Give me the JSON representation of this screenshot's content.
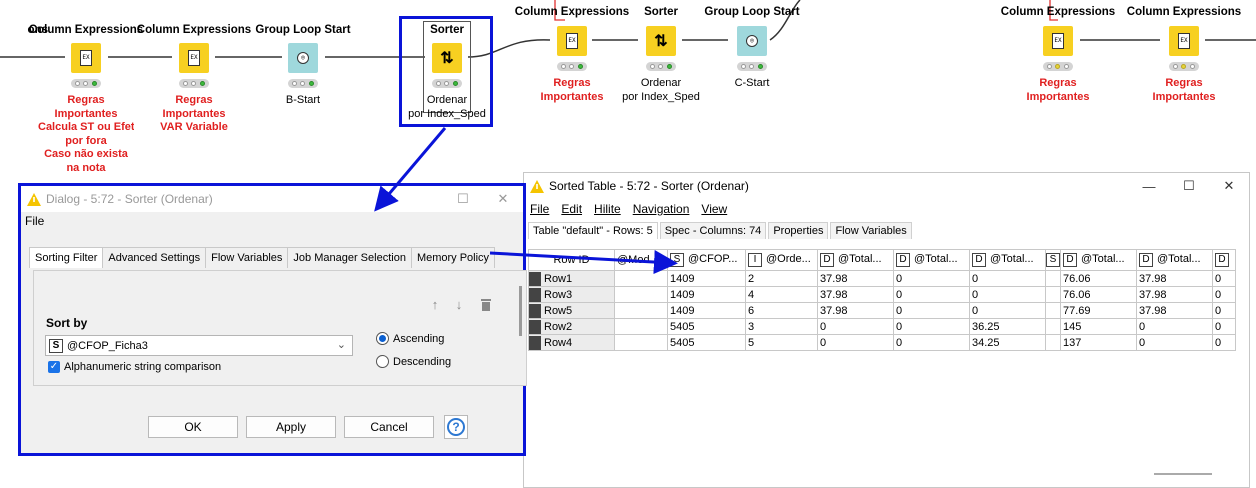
{
  "canvas": {
    "nodes": [
      {
        "title": "ons",
        "label": [],
        "status": [
          "w",
          "w",
          "w"
        ],
        "type": "none"
      },
      {
        "title": "Column Expressions",
        "label": [
          "Regras",
          "Importantes",
          "Calcula ST ou Efetivo",
          "por fora",
          "Caso não exista",
          "na nota"
        ],
        "status": [
          "w",
          "w",
          "g"
        ],
        "type": "expr"
      },
      {
        "title": "Column Expressions",
        "label": [
          "Regras",
          "Importantes",
          "VAR Variable"
        ],
        "status": [
          "w",
          "w",
          "g"
        ],
        "type": "expr"
      },
      {
        "title": "Group Loop Start",
        "label": [
          "B-Start"
        ],
        "status": [
          "w",
          "w",
          "g"
        ],
        "type": "loop"
      },
      {
        "title": "Sorter",
        "label": [
          "Ordenar",
          "por Index_Sped"
        ],
        "status": [
          "w",
          "w",
          "g"
        ],
        "type": "sort"
      },
      {
        "title": "Column Expressions",
        "label": [
          "Regras",
          "Importantes"
        ],
        "status": [
          "w",
          "w",
          "g"
        ],
        "type": "expr"
      },
      {
        "title": "Sorter",
        "label": [
          "Ordenar",
          "por Index_Sped"
        ],
        "status": [
          "w",
          "w",
          "g"
        ],
        "type": "sort"
      },
      {
        "title": "Group Loop Start",
        "label": [
          "C-Start"
        ],
        "status": [
          "w",
          "w",
          "g"
        ],
        "type": "loop"
      },
      {
        "title": "Column Expressions",
        "label": [
          "Regras",
          "Importantes"
        ],
        "status": [
          "w",
          "y",
          "w"
        ],
        "type": "expr"
      },
      {
        "title": "Column Expressions",
        "label": [
          "Regras",
          "Importantes"
        ],
        "status": [
          "w",
          "y",
          "w"
        ],
        "type": "expr"
      }
    ]
  },
  "dialog": {
    "title": "Dialog - 5:72 - Sorter (Ordenar)",
    "menu": [
      "File"
    ],
    "tabs": [
      "Sorting Filter",
      "Advanced Settings",
      "Flow Variables",
      "Job Manager Selection",
      "Memory Policy"
    ],
    "sort_by_label": "Sort by",
    "column_type": "S",
    "selected_column": "@CFOP_Ficha3",
    "checkbox_label": "Alphanumeric string comparison",
    "checkbox_checked": true,
    "radio_ascending": "Ascending",
    "radio_descending": "Descending",
    "ascending_selected": true,
    "ok_label": "OK",
    "apply_label": "Apply",
    "cancel_label": "Cancel",
    "help_label": "?"
  },
  "table_window": {
    "title": "Sorted Table - 5:72 - Sorter (Ordenar)",
    "menu": [
      "File",
      "Edit",
      "Hilite",
      "Navigation",
      "View"
    ],
    "subtabs": [
      "Table \"default\" - Rows: 5",
      "Spec - Columns: 74",
      "Properties",
      "Flow Variables"
    ],
    "columns": [
      {
        "type": "",
        "name": "Row ID"
      },
      {
        "type": "",
        "name": "@Mod..."
      },
      {
        "type": "S",
        "name": "@CFOP..."
      },
      {
        "type": "I",
        "name": "@Orde..."
      },
      {
        "type": "D",
        "name": "@Total..."
      },
      {
        "type": "D",
        "name": "@Total..."
      },
      {
        "type": "D",
        "name": "@Total..."
      },
      {
        "type": "S",
        "name": ""
      },
      {
        "type": "D",
        "name": "@Total..."
      },
      {
        "type": "D",
        "name": "@Total..."
      },
      {
        "type": "D",
        "name": ""
      }
    ],
    "rows": [
      [
        "Row1",
        "",
        "1409",
        "2",
        "37.98",
        "0",
        "0",
        "",
        "76.06",
        "37.98",
        "0"
      ],
      [
        "Row3",
        "",
        "1409",
        "4",
        "37.98",
        "0",
        "0",
        "",
        "76.06",
        "37.98",
        "0"
      ],
      [
        "Row5",
        "",
        "1409",
        "6",
        "37.98",
        "0",
        "0",
        "",
        "77.69",
        "37.98",
        "0"
      ],
      [
        "Row2",
        "",
        "5405",
        "3",
        "0",
        "0",
        "36.25",
        "",
        "145",
        "0",
        "0"
      ],
      [
        "Row4",
        "",
        "5405",
        "5",
        "0",
        "0",
        "34.25",
        "",
        "137",
        "0",
        "0"
      ]
    ]
  },
  "colors": {
    "highlight": "#0a14d8",
    "node_yellow": "#f7d021",
    "node_teal": "#9fd8dc",
    "label_red": "#e02020",
    "status_green": "#3dbb3d"
  }
}
